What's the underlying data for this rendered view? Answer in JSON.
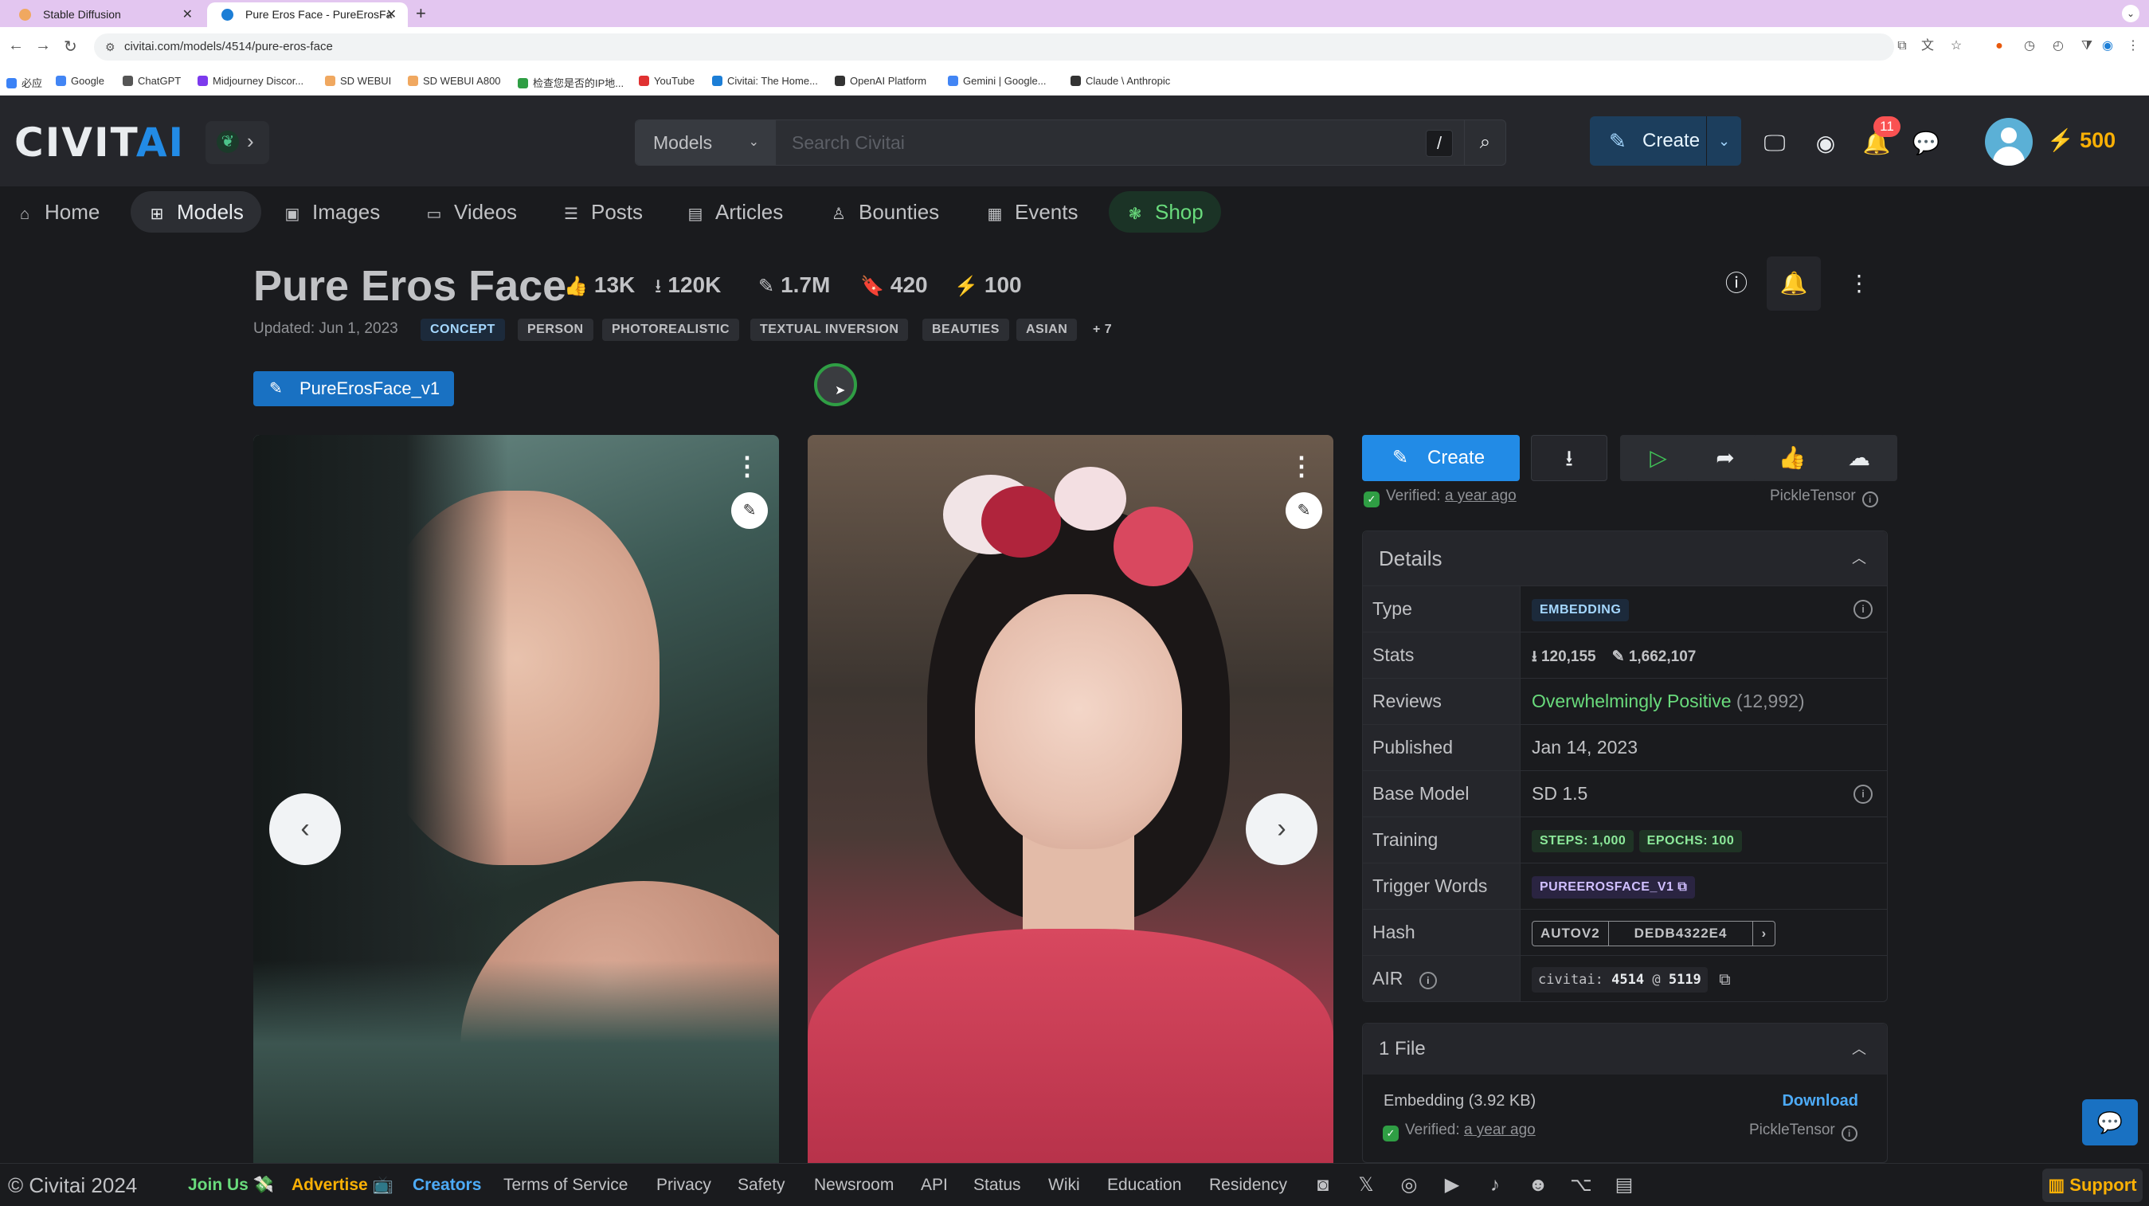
{
  "browser": {
    "tabs": [
      {
        "label": "Stable Diffusion"
      },
      {
        "label": "Pure Eros Face - PureErosFa"
      }
    ],
    "url": "civitai.com/models/4514/pure-eros-face",
    "bookmarks": [
      "必应",
      "Google",
      "ChatGPT",
      "Midjourney Discor...",
      "SD WEBUI",
      "SD WEBUI A800",
      "检查您是否的IP地...",
      "YouTube",
      "Civitai: The Home...",
      "OpenAI Platform",
      "Gemini | Google...",
      "Claude \\ Anthropic"
    ]
  },
  "header": {
    "logo_main": "CIVIT",
    "logo_accent": "AI",
    "search_category": "Models",
    "search_placeholder": "Search Civitai",
    "search_shortcut": "/",
    "create_label": "Create",
    "notifications": "11",
    "buzz": "500"
  },
  "nav": {
    "items": [
      {
        "label": "Home",
        "icon": "home-icon"
      },
      {
        "label": "Models",
        "icon": "grid-icon"
      },
      {
        "label": "Images",
        "icon": "image-icon"
      },
      {
        "label": "Videos",
        "icon": "video-icon"
      },
      {
        "label": "Posts",
        "icon": "posts-icon"
      },
      {
        "label": "Articles",
        "icon": "article-icon"
      },
      {
        "label": "Bounties",
        "icon": "bounty-icon"
      },
      {
        "label": "Events",
        "icon": "calendar-icon"
      },
      {
        "label": "Shop",
        "icon": "shop-icon"
      }
    ]
  },
  "model": {
    "title": "Pure Eros Face",
    "likes": "13K",
    "downloads": "120K",
    "generations": "1.7M",
    "collected": "420",
    "buzz": "100",
    "updated": "Updated: Jun 1, 2023",
    "tags": [
      "CONCEPT",
      "PERSON",
      "PHOTOREALISTIC",
      "TEXTUAL INVERSION",
      "BEAUTIES",
      "ASIAN",
      "+ 7"
    ],
    "version": "PureErosFace_v1"
  },
  "actions": {
    "create_label": "Create",
    "verified_label": "Verified:",
    "verified_ago": "a year ago",
    "scanner": "PickleTensor"
  },
  "details": {
    "title": "Details",
    "rows": {
      "type_label": "Type",
      "type_value": "EMBEDDING",
      "stats_label": "Stats",
      "stats_downloads": "120,155",
      "stats_generations": "1,662,107",
      "reviews_label": "Reviews",
      "reviews_value": "Overwhelmingly Positive",
      "reviews_count": "(12,992)",
      "published_label": "Published",
      "published_value": "Jan 14, 2023",
      "base_label": "Base Model",
      "base_value": "SD 1.5",
      "training_label": "Training",
      "training_steps": "STEPS: 1,000",
      "training_epochs": "EPOCHS: 100",
      "trigger_label": "Trigger Words",
      "trigger_value": "PUREEROSFACE_V1",
      "hash_label": "Hash",
      "hash_type": "AUTOV2",
      "hash_value": "DEDB4322E4",
      "air_label": "AIR",
      "air_prefix": "civitai:",
      "air_model": "4514",
      "air_at": "@",
      "air_version": "5119"
    }
  },
  "files": {
    "title": "1 File",
    "name": "Embedding (3.92 KB)",
    "download_label": "Download",
    "verified_label": "Verified:",
    "verified_ago": "a year ago",
    "scanner": "PickleTensor"
  },
  "footer": {
    "copyright": "© Civitai 2024",
    "join": "Join Us 💸",
    "advertise": "Advertise 📺",
    "links": [
      "Creators",
      "Terms of Service",
      "Privacy",
      "Safety",
      "Newsroom",
      "API",
      "Status",
      "Wiki",
      "Education",
      "Residency"
    ],
    "support": "Support"
  }
}
